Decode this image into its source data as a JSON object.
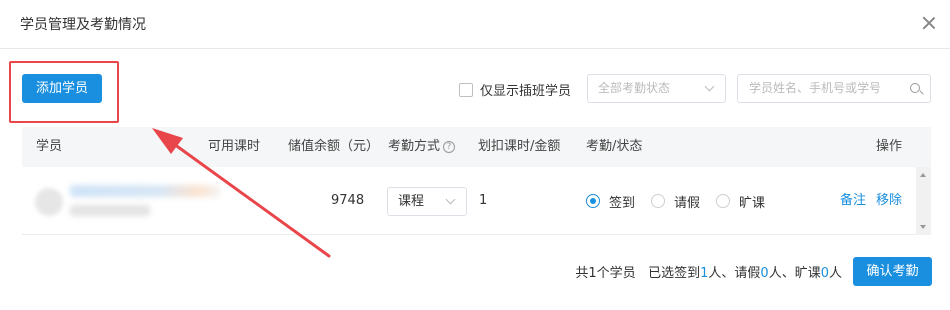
{
  "dialog": {
    "title": "学员管理及考勤情况"
  },
  "toolbar": {
    "add_student_label": "添加学员",
    "only_insert_label": "仅显示插班学员",
    "status_select_value": "全部考勤状态",
    "search_placeholder": "学员姓名、手机号或学号"
  },
  "table": {
    "headers": {
      "student": "学员",
      "available_hours": "可用课时",
      "balance": "储值余额（元）",
      "attendance_method": "考勤方式",
      "deduct": "划扣课时/金额",
      "attendance_status": "考勤/状态",
      "actions": "操作"
    },
    "rows": [
      {
        "balance": "9748",
        "method": "课程",
        "deduct": "1",
        "options": {
          "sign": "签到",
          "leave": "请假",
          "absent": "旷课"
        },
        "selected": "sign",
        "actions": {
          "note": "备注",
          "remove": "移除"
        }
      }
    ]
  },
  "footer": {
    "total_prefix": "共",
    "total_count": "1",
    "total_suffix": "个学员",
    "selected_prefix": "已选签到",
    "signed": "1",
    "sep1": "人、请假",
    "leave": "0",
    "sep2": "人、旷课",
    "absent": "0",
    "suffix": "人",
    "confirm_label": "确认考勤"
  },
  "colors": {
    "primary": "#1a8fe0",
    "annotation": "#e8464a"
  },
  "icons": {
    "close": "close-icon",
    "search": "search-icon",
    "help": "question-circle-icon",
    "chevron": "chevron-down-icon"
  }
}
